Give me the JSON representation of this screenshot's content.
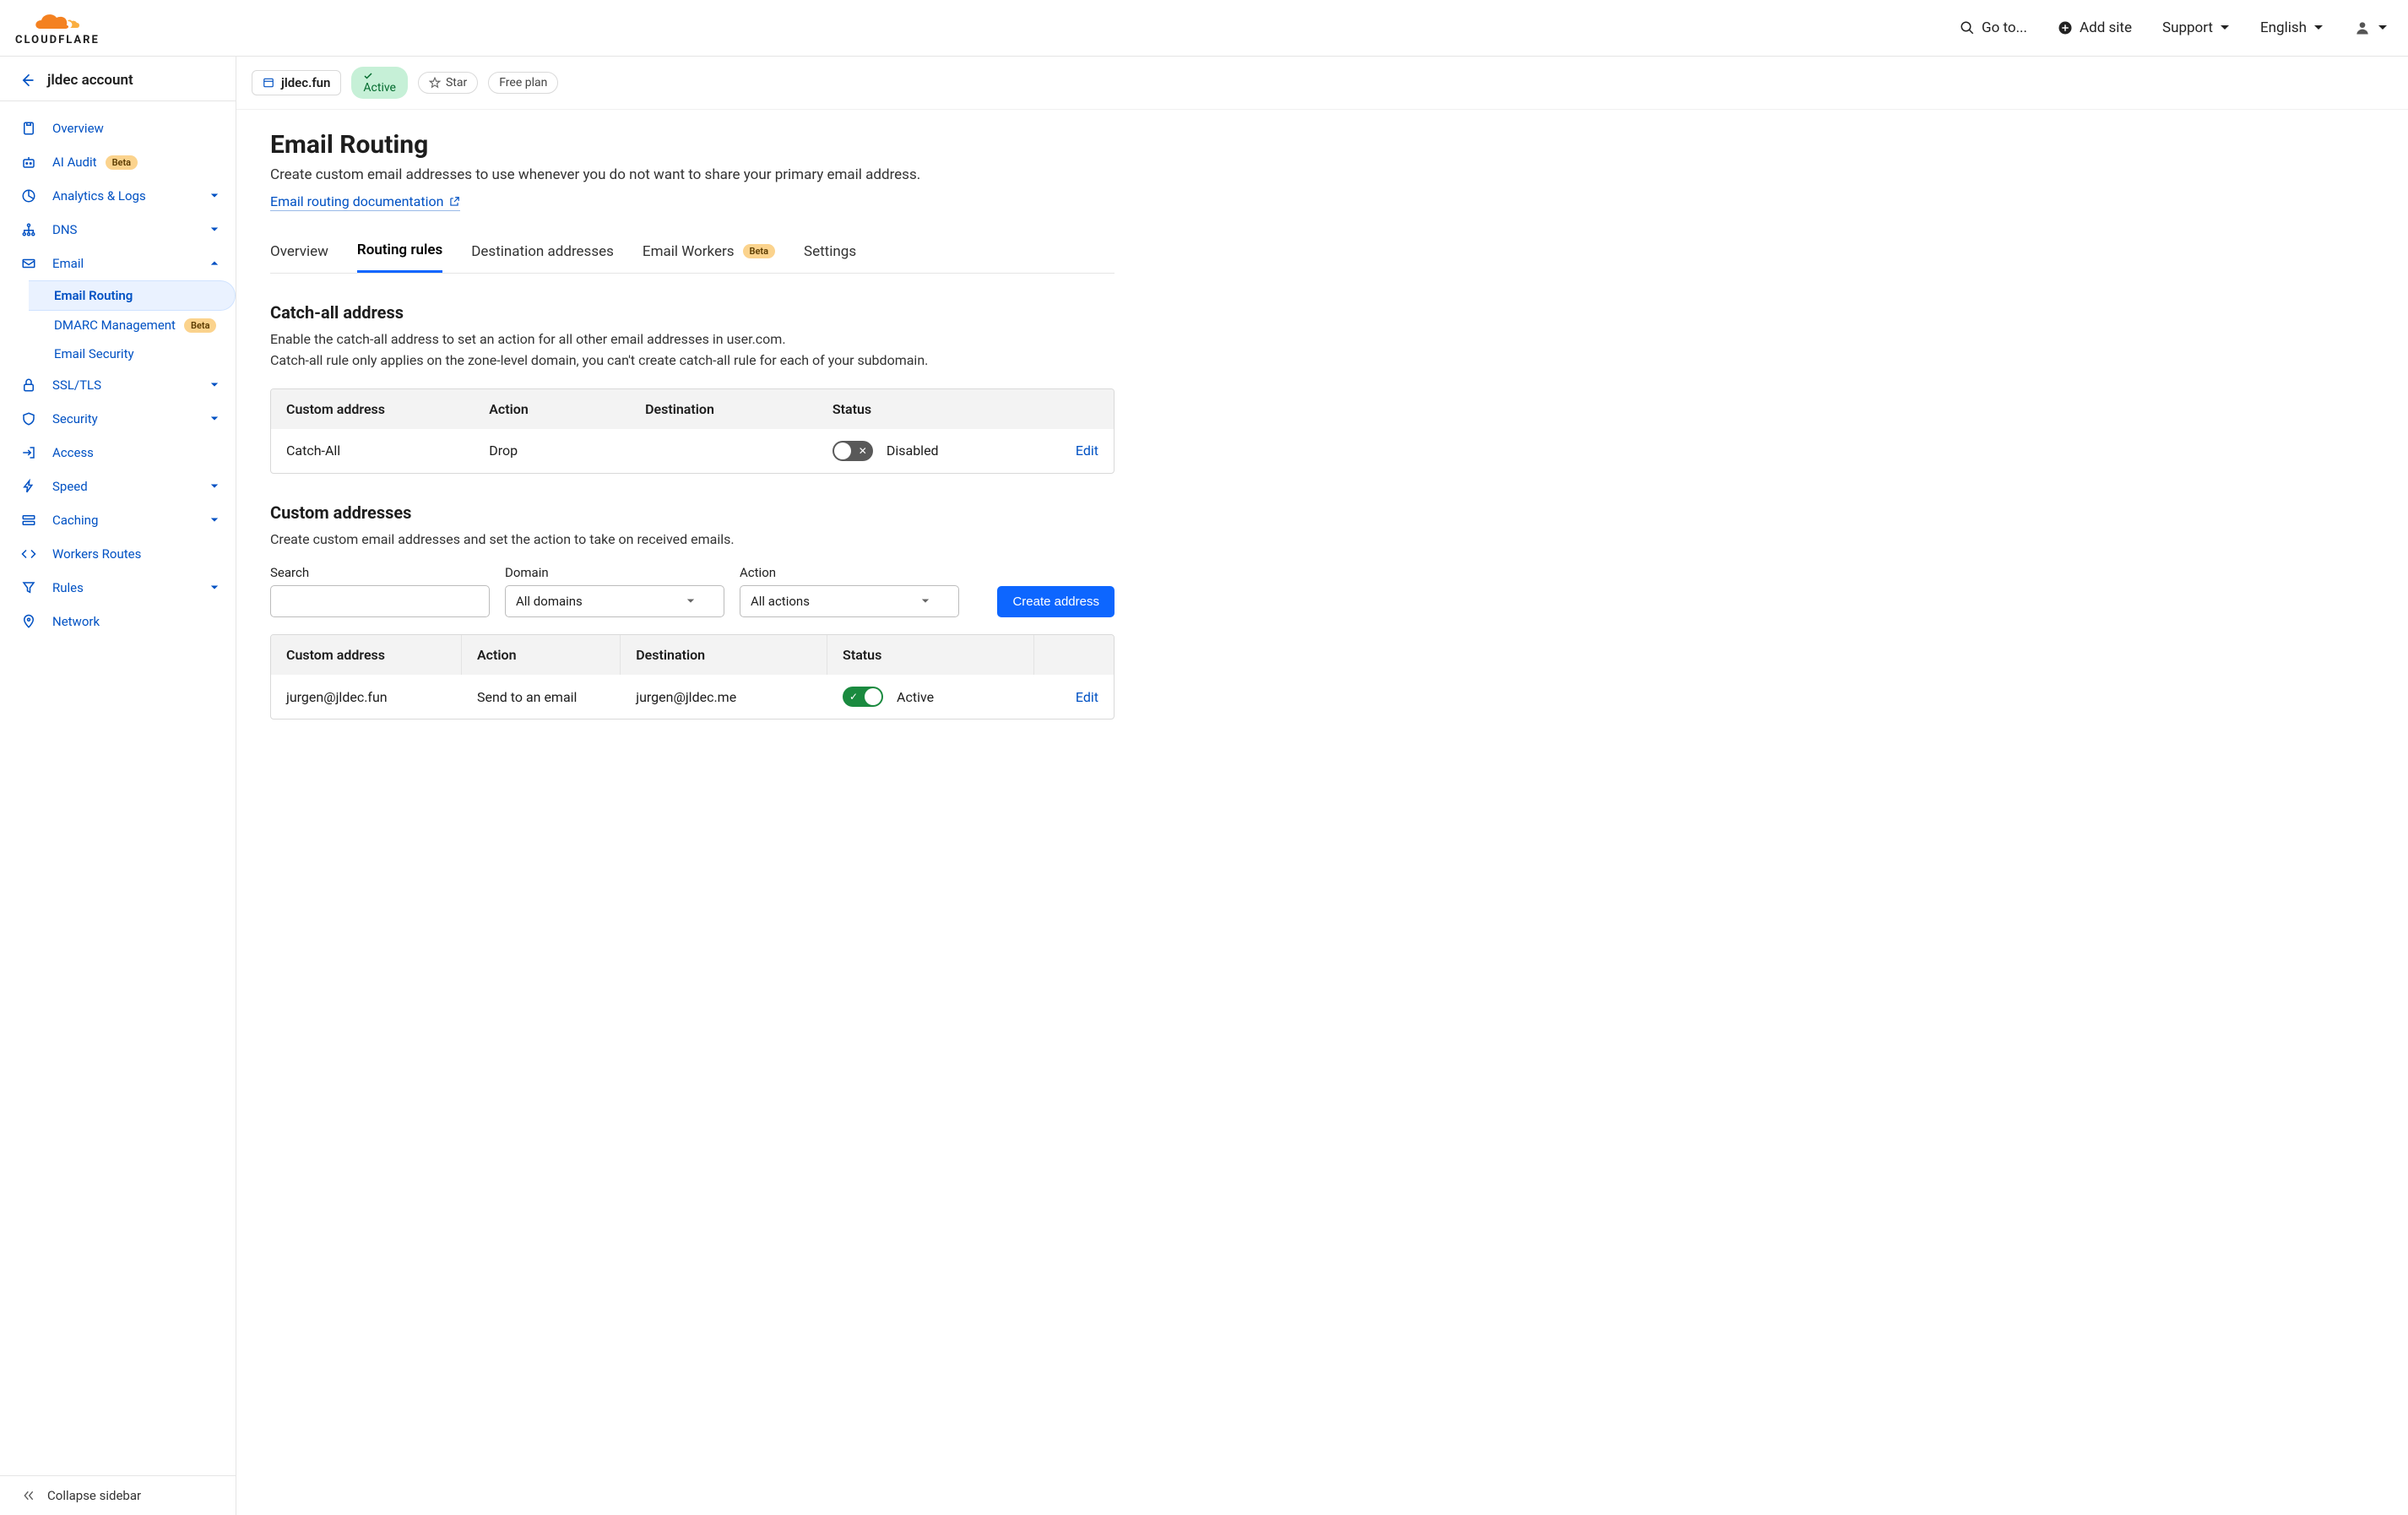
{
  "topbar": {
    "logo_text": "CLOUDFLARE",
    "goto": "Go to...",
    "add_site": "Add site",
    "support": "Support",
    "language": "English"
  },
  "sidebar": {
    "account_name": "jldec account",
    "collapse": "Collapse sidebar",
    "items": [
      {
        "label": "Overview"
      },
      {
        "label": "AI Audit",
        "beta": "Beta"
      },
      {
        "label": "Analytics & Logs",
        "chev": true
      },
      {
        "label": "DNS",
        "chev": true
      },
      {
        "label": "Email",
        "expanded": true
      },
      {
        "label": "SSL/TLS",
        "chev": true
      },
      {
        "label": "Security",
        "chev": true
      },
      {
        "label": "Access"
      },
      {
        "label": "Speed",
        "chev": true
      },
      {
        "label": "Caching",
        "chev": true
      },
      {
        "label": "Workers Routes"
      },
      {
        "label": "Rules",
        "chev": true
      },
      {
        "label": "Network"
      }
    ],
    "email_sub": [
      {
        "label": "Email Routing",
        "active": true
      },
      {
        "label": "DMARC Management",
        "beta": "Beta"
      },
      {
        "label": "Email Security"
      }
    ]
  },
  "strip": {
    "domain": "jldec.fun",
    "active": "Active",
    "star": "Star",
    "plan": "Free plan"
  },
  "page": {
    "title": "Email Routing",
    "desc": "Create custom email addresses to use whenever you do not want to share your primary email address.",
    "doc_link": "Email routing documentation"
  },
  "tabs": [
    {
      "label": "Overview"
    },
    {
      "label": "Routing rules",
      "active": true
    },
    {
      "label": "Destination addresses"
    },
    {
      "label": "Email Workers",
      "beta": "Beta"
    },
    {
      "label": "Settings"
    }
  ],
  "catchall": {
    "heading": "Catch-all address",
    "desc1": "Enable the catch-all address to set an action for all other email addresses in user.com.",
    "desc2": "Catch-all rule only applies on the zone-level domain, you can't create catch-all rule for each of your subdomain.",
    "headers": {
      "addr": "Custom address",
      "action": "Action",
      "dest": "Destination",
      "status": "Status"
    },
    "row": {
      "addr": "Catch-All",
      "action": "Drop",
      "dest": "",
      "status_label": "Disabled",
      "edit": "Edit"
    }
  },
  "custom": {
    "heading": "Custom addresses",
    "desc": "Create custom email addresses and set the action to take on received emails.",
    "filters": {
      "search_label": "Search",
      "domain_label": "Domain",
      "domain_value": "All domains",
      "action_label": "Action",
      "action_value": "All actions",
      "create_btn": "Create address"
    },
    "headers": {
      "addr": "Custom address",
      "action": "Action",
      "dest": "Destination",
      "status": "Status"
    },
    "rows": [
      {
        "addr": "jurgen@jldec.fun",
        "action": "Send to an email",
        "dest": "jurgen@jldec.me",
        "status_label": "Active",
        "edit": "Edit"
      }
    ]
  }
}
